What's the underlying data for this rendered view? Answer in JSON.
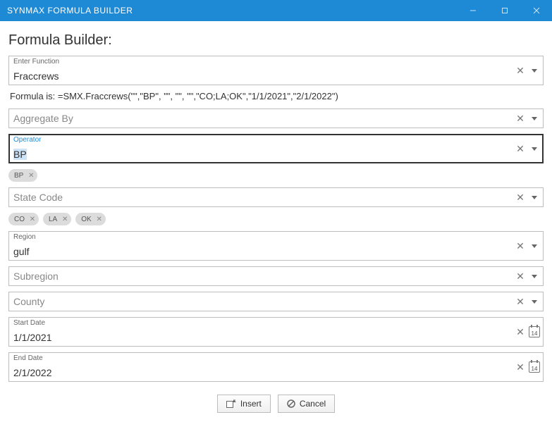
{
  "titlebar": "SYNMAX FORMULA BUILDER",
  "page_title": "Formula Builder:",
  "enter_function": {
    "label": "Enter Function",
    "value": "Fraccrews"
  },
  "formula_prefix": "Formula is:  ",
  "formula_value": "=SMX.Fraccrews(\"\",\"BP\", \"\", \"\", \"\",\"CO;LA;OK\",\"1/1/2021\",\"2/1/2022\")",
  "aggregate_by": {
    "placeholder": "Aggregate By"
  },
  "operator": {
    "label": "Operator",
    "value": "BP"
  },
  "operator_chips": [
    "BP"
  ],
  "state_code": {
    "placeholder": "State Code"
  },
  "state_chips": [
    "CO",
    "LA",
    "OK"
  ],
  "region": {
    "label": "Region",
    "value": "gulf"
  },
  "subregion": {
    "placeholder": "Subregion"
  },
  "county": {
    "placeholder": "County"
  },
  "start_date": {
    "label": "Start Date",
    "value": "1/1/2021"
  },
  "end_date": {
    "label": "End Date",
    "value": "2/1/2022"
  },
  "calendar_day": "14",
  "buttons": {
    "insert": "Insert",
    "cancel": "Cancel"
  }
}
